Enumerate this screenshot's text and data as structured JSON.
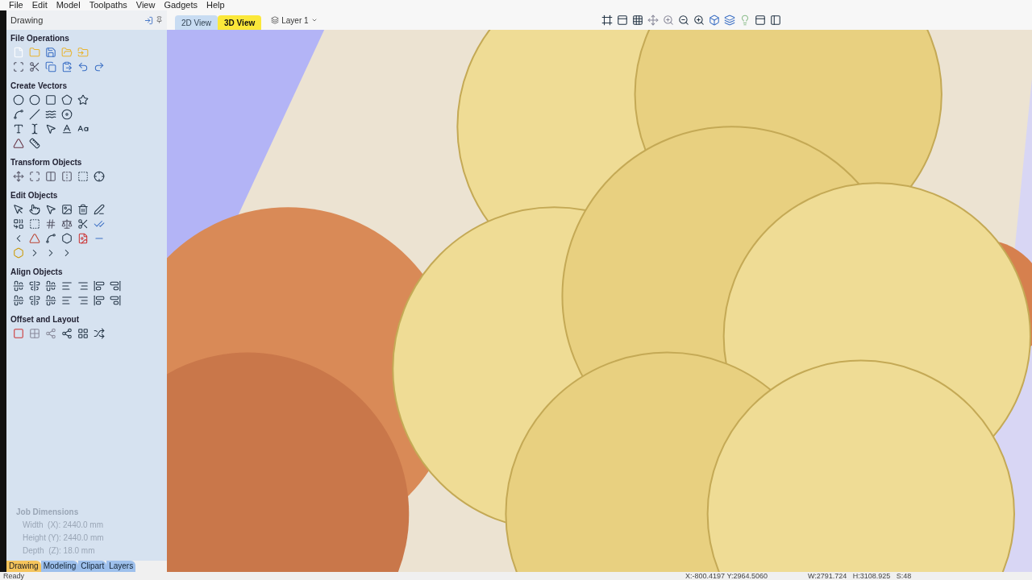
{
  "menu_bar": [
    "File",
    "Edit",
    "Model",
    "Toolpaths",
    "View",
    "Gadgets",
    "Help"
  ],
  "panel": {
    "title": "Drawing",
    "sections": [
      {
        "title": "File Operations"
      },
      {
        "title": "Create Vectors"
      },
      {
        "title": "Transform Objects"
      },
      {
        "title": "Edit Objects"
      },
      {
        "title": "Align Objects"
      },
      {
        "title": "Offset and Layout"
      }
    ],
    "job_dimensions": {
      "title": "Job Dimensions",
      "lines": [
        "Width  (X): 2440.0 mm",
        "Height (Y): 2440.0 mm",
        "Depth  (Z): 18.0 mm"
      ]
    },
    "tabs": [
      {
        "label": "Drawing",
        "selected": true
      },
      {
        "label": "Modeling",
        "selected": false
      },
      {
        "label": "Clipart",
        "selected": false
      },
      {
        "label": "Layers",
        "selected": false
      }
    ]
  },
  "view_tabs": [
    {
      "label": "2D View",
      "selected": false
    },
    {
      "label": "3D View",
      "selected": true
    }
  ],
  "layer": "Layer 1",
  "status_bar": {
    "message": "Ready",
    "cursor": "X:-800.4197 Y:2964.5060",
    "size": "W:2791.724   H:3108.925   S:48"
  }
}
